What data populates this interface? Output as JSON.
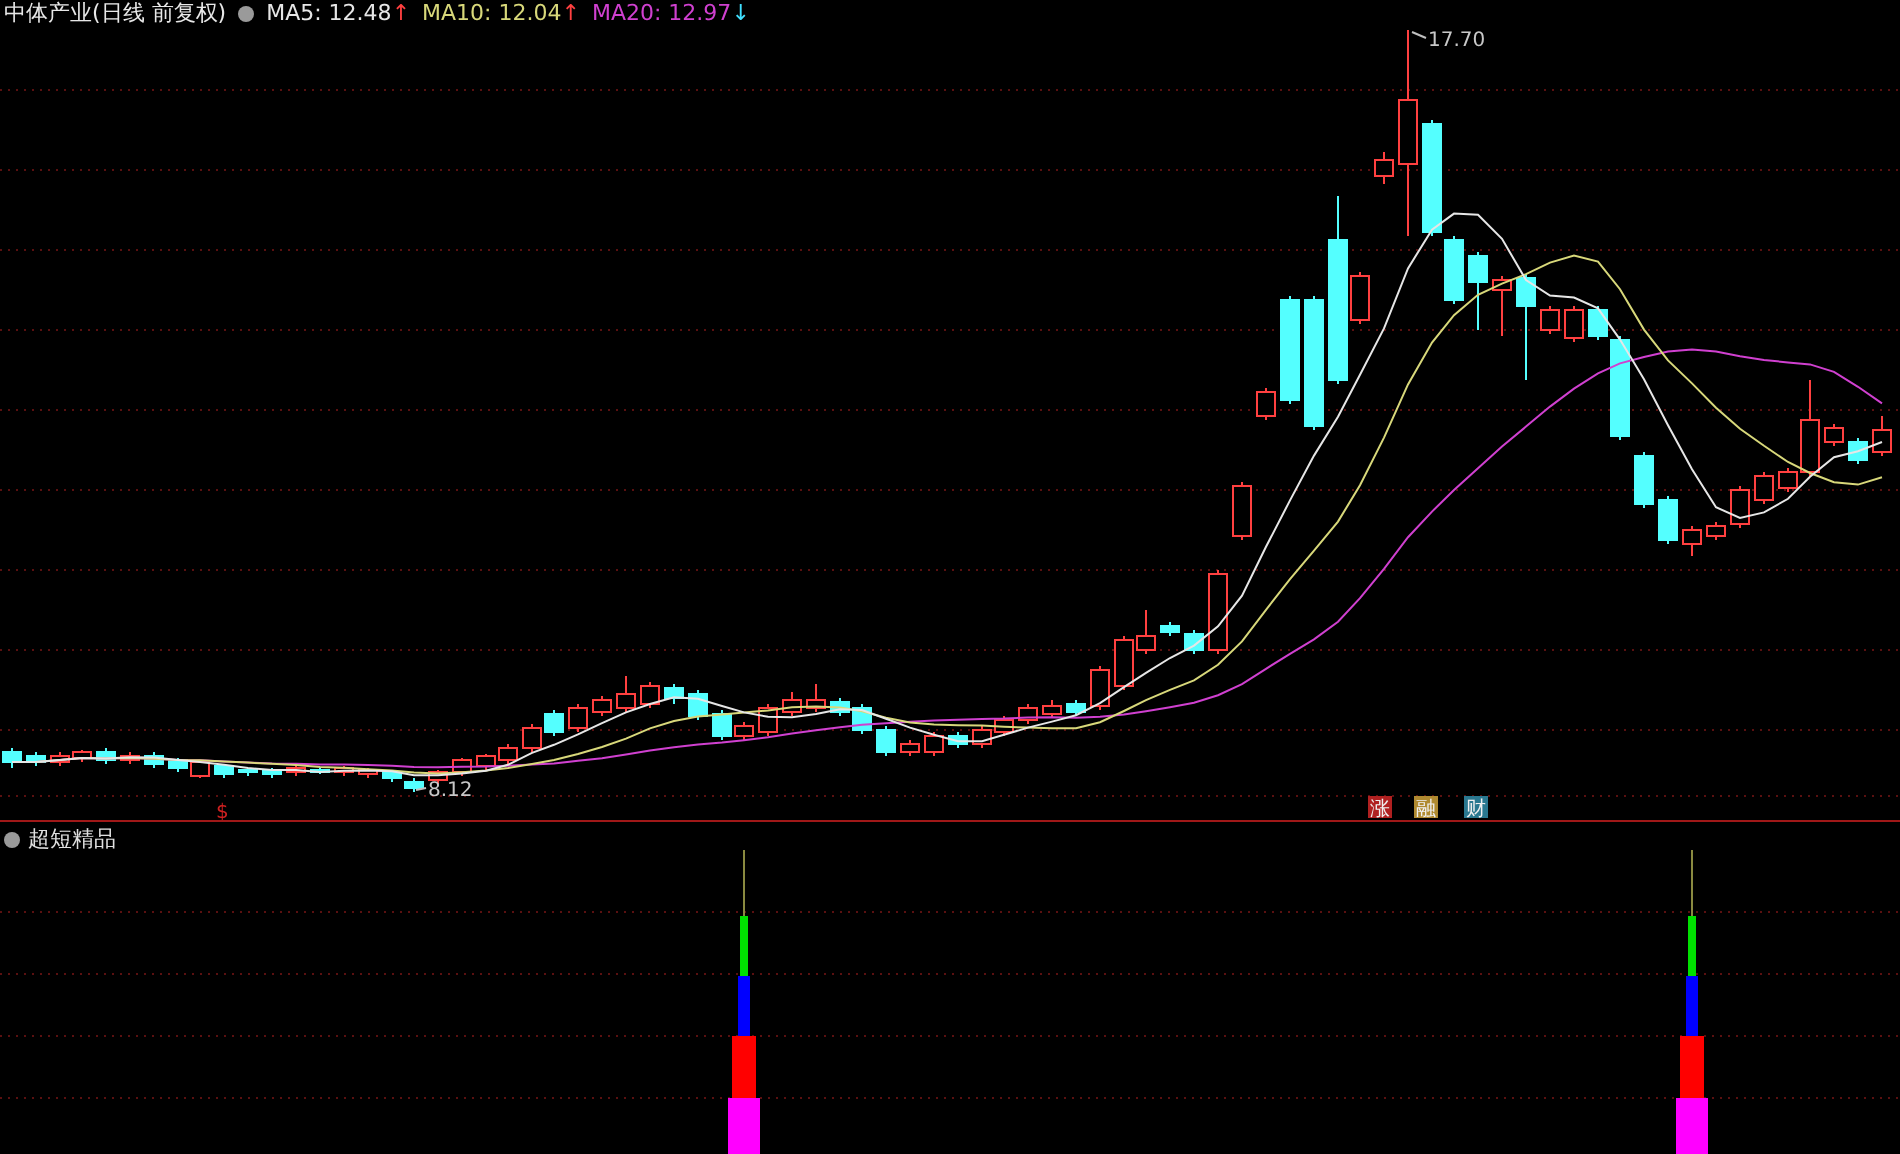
{
  "header": {
    "title": "中体产业(日线 前复权)",
    "indicators": [
      {
        "label": "MA5: 12.48",
        "color": "#e6e6e6",
        "arrow": "↑",
        "rising": true
      },
      {
        "label": "MA10: 12.04",
        "color": "#d8d87a",
        "arrow": "↑",
        "rising": true
      },
      {
        "label": "MA20: 12.97",
        "color": "#d040d0",
        "arrow": "↓",
        "rising": false
      }
    ]
  },
  "price_chart": {
    "high_label": "17.70",
    "low_label": "8.12",
    "markers": [
      {
        "text": "$",
        "kind": "plain",
        "color": "#d02020"
      },
      {
        "text": "涨",
        "kind": "tag",
        "color": "#b02020"
      },
      {
        "text": "融",
        "kind": "tag",
        "color": "#b08a30"
      },
      {
        "text": "财",
        "kind": "tag",
        "color": "#2a7890"
      }
    ]
  },
  "indicator_panel": {
    "title": "超短精品"
  }
}
